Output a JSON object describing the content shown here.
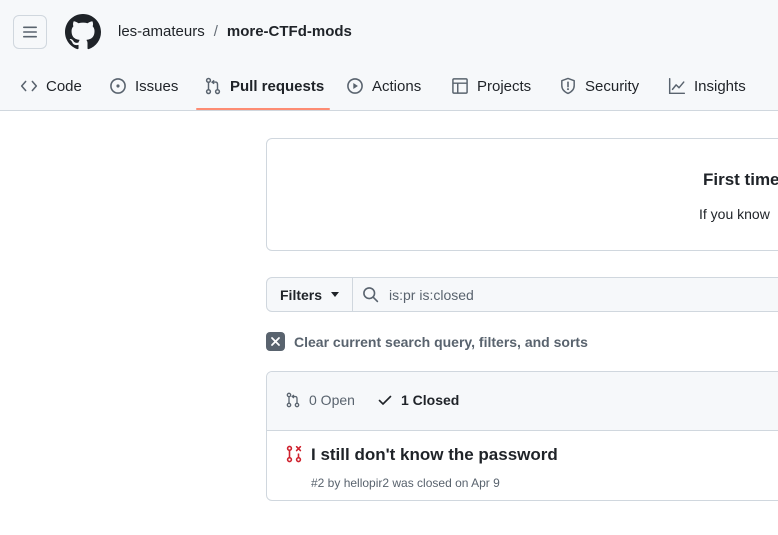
{
  "header": {
    "owner": "les-amateurs",
    "separator": "/",
    "repo": "more-CTFd-mods"
  },
  "tabs": [
    {
      "label": "Code",
      "icon": "code-icon"
    },
    {
      "label": "Issues",
      "icon": "issue-opened-icon"
    },
    {
      "label": "Pull requests",
      "icon": "git-pull-request-icon",
      "active": true
    },
    {
      "label": "Actions",
      "icon": "play-icon"
    },
    {
      "label": "Projects",
      "icon": "table-icon"
    },
    {
      "label": "Security",
      "icon": "shield-icon"
    },
    {
      "label": "Insights",
      "icon": "graph-icon"
    }
  ],
  "banner": {
    "title": "First time",
    "text": "If you know"
  },
  "filters": {
    "button_label": "Filters",
    "search_value": "is:pr is:closed"
  },
  "clear_filters": {
    "label": "Clear current search query, filters, and sorts"
  },
  "list": {
    "open_label": "0 Open",
    "closed_label": "1 Closed",
    "items": [
      {
        "title": "I still don't know the password",
        "meta": "#2 by hellopir2 was closed on Apr 9",
        "state_color": "#cf222e"
      }
    ]
  },
  "colors": {
    "accent_underline": "#fd8c73",
    "closed_pr": "#cf222e"
  }
}
